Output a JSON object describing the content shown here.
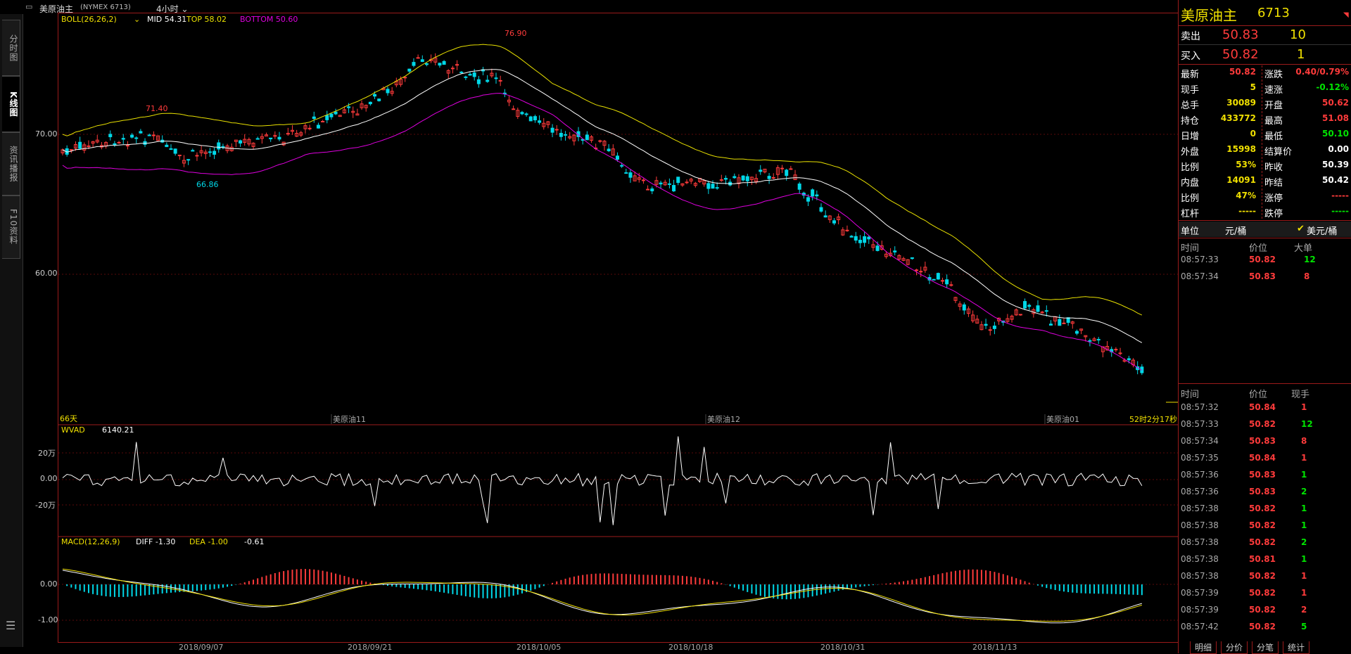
{
  "title": {
    "name": "美原油主",
    "code": "(NYMEX 6713)",
    "period": "4小时"
  },
  "left_tabs": [
    "分时图",
    "K线图",
    "资讯播报",
    "F10资料"
  ],
  "boll": {
    "label": "BOLL(26,26,2)",
    "mid": "MID 54.31",
    "top": "TOP 58.02",
    "bottom": "BOTTOM 50.60",
    "colors": {
      "mid": "#ffffff",
      "top": "#e8e000",
      "bottom": "#e000e0"
    }
  },
  "price_axis": [
    "70.00",
    "60.00"
  ],
  "price_markers": {
    "high_label": "76.90",
    "left_high": "71.40",
    "left_low": "66.86"
  },
  "bottom_labels": {
    "days": "66天",
    "m1": "美原油11",
    "m2": "美原油12",
    "m3": "美原油01",
    "timer": "52时2分17秒"
  },
  "wvad": {
    "label": "WVAD",
    "value": "6140.21",
    "axis": [
      "20万",
      "0.00",
      "-20万"
    ]
  },
  "macd": {
    "label": "MACD(12,26,9)",
    "diff": "DIFF -1.30",
    "dea": "DEA -1.00",
    "macd": "-0.61",
    "axis": [
      "0.00",
      "-1.00"
    ]
  },
  "date_axis": [
    "2018/09/07",
    "2018/09/21",
    "2018/10/05",
    "2018/10/18",
    "2018/10/31",
    "2018/11/13"
  ],
  "quote": {
    "name": "美原油主",
    "code": "6713",
    "sell_label": "卖出",
    "sell_price": "50.83",
    "sell_vol": "10",
    "buy_label": "买入",
    "buy_price": "50.82",
    "buy_vol": "1",
    "stats_left": [
      {
        "k": "最新",
        "v": "50.82",
        "c": "red"
      },
      {
        "k": "现手",
        "v": "5",
        "c": "yel"
      },
      {
        "k": "总手",
        "v": "30089",
        "c": "yel"
      },
      {
        "k": "持仓",
        "v": "433772",
        "c": "yel"
      },
      {
        "k": "日增",
        "v": "0",
        "c": "yel"
      },
      {
        "k": "外盘",
        "v": "15998",
        "c": "yel"
      },
      {
        "k": "比例",
        "v": "53%",
        "c": "yel"
      },
      {
        "k": "内盘",
        "v": "14091",
        "c": "yel"
      },
      {
        "k": "比例",
        "v": "47%",
        "c": "yel"
      },
      {
        "k": "杠杆",
        "v": "-----",
        "c": "yel"
      }
    ],
    "stats_right": [
      {
        "k": "涨跌",
        "v": "0.40/0.79%",
        "c": "red"
      },
      {
        "k": "速涨",
        "v": "-0.12%",
        "c": "grn"
      },
      {
        "k": "开盘",
        "v": "50.62",
        "c": "red"
      },
      {
        "k": "最高",
        "v": "51.08",
        "c": "red"
      },
      {
        "k": "最低",
        "v": "50.10",
        "c": "grn"
      },
      {
        "k": "结算价",
        "v": "0.00",
        "c": "wht"
      },
      {
        "k": "昨收",
        "v": "50.39",
        "c": "wht"
      },
      {
        "k": "昨结",
        "v": "50.42",
        "c": "wht"
      },
      {
        "k": "涨停",
        "v": "-----",
        "c": "red"
      },
      {
        "k": "跌停",
        "v": "-----",
        "c": "grn"
      }
    ],
    "unit_label": "单位",
    "unit_a": "元/桶",
    "unit_b": "美元/桶"
  },
  "big_trades": {
    "headers": [
      "时间",
      "价位",
      "大单"
    ],
    "rows": [
      {
        "t": "08:57:33",
        "p": "50.82",
        "v": "12",
        "vc": "grn"
      },
      {
        "t": "08:57:34",
        "p": "50.83",
        "v": "8",
        "vc": "red"
      }
    ]
  },
  "ticks": {
    "headers": [
      "时间",
      "价位",
      "现手"
    ],
    "rows": [
      {
        "t": "08:57:32",
        "p": "50.84",
        "v": "1",
        "vc": "red"
      },
      {
        "t": "08:57:33",
        "p": "50.82",
        "v": "12",
        "vc": "grn"
      },
      {
        "t": "08:57:34",
        "p": "50.83",
        "v": "8",
        "vc": "red"
      },
      {
        "t": "08:57:35",
        "p": "50.84",
        "v": "1",
        "vc": "red"
      },
      {
        "t": "08:57:36",
        "p": "50.83",
        "v": "1",
        "vc": "grn"
      },
      {
        "t": "08:57:36",
        "p": "50.83",
        "v": "2",
        "vc": "grn"
      },
      {
        "t": "08:57:38",
        "p": "50.82",
        "v": "1",
        "vc": "grn"
      },
      {
        "t": "08:57:38",
        "p": "50.82",
        "v": "1",
        "vc": "grn"
      },
      {
        "t": "08:57:38",
        "p": "50.82",
        "v": "2",
        "vc": "grn"
      },
      {
        "t": "08:57:38",
        "p": "50.81",
        "v": "1",
        "vc": "grn"
      },
      {
        "t": "08:57:38",
        "p": "50.82",
        "v": "1",
        "vc": "red"
      },
      {
        "t": "08:57:39",
        "p": "50.82",
        "v": "1",
        "vc": "red"
      },
      {
        "t": "08:57:39",
        "p": "50.82",
        "v": "2",
        "vc": "red"
      },
      {
        "t": "08:57:42",
        "p": "50.82",
        "v": "5",
        "vc": "grn"
      }
    ]
  },
  "bottom_tabs": [
    "明细",
    "分价",
    "分笔",
    "统计"
  ]
}
